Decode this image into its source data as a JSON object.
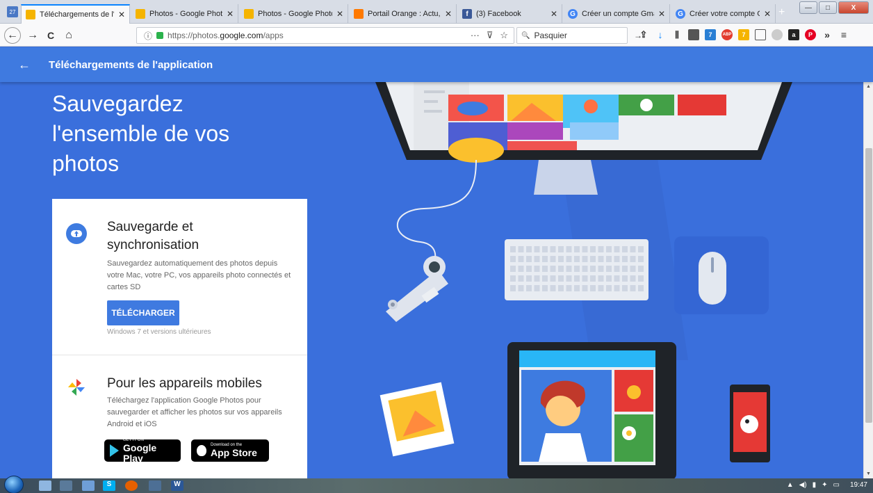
{
  "browser": {
    "tabs": [
      {
        "label": "Téléchargements de l'ap",
        "icon": "google-photos-icon",
        "active": true
      },
      {
        "label": "Photos - Google Photos",
        "icon": "google-photos-icon",
        "active": false
      },
      {
        "label": "Photos - Google Photos",
        "icon": "google-photos-icon",
        "active": false
      },
      {
        "label": "Portail Orange : Actu, Sp",
        "icon": "orange-icon",
        "active": false
      },
      {
        "label": "(3) Facebook",
        "icon": "facebook-icon",
        "active": false
      },
      {
        "label": "Créer un compte Gmail",
        "icon": "google-icon",
        "active": false
      },
      {
        "label": "Créer votre compte Goo",
        "icon": "google-icon",
        "active": false
      }
    ],
    "tab_close_glyph": "✕",
    "new_tab_glyph": "+",
    "calendar_badge": "27",
    "window": {
      "minimize": "—",
      "maximize": "□",
      "close": "X"
    },
    "url": {
      "scheme": "https://photos.",
      "host": "google.com",
      "path": "/apps"
    },
    "search_value": "Pasquier",
    "nav": {
      "back": "←",
      "forward": "→",
      "reload": "C",
      "home": "⌂"
    },
    "url_actions": {
      "more": "···",
      "pocket": "⊽",
      "bookmark": "☆"
    },
    "info_glyph": "ⓘ",
    "search_glyph": "🔍",
    "go_glyph": "→",
    "toolbar_badges": {
      "ext1": "7",
      "abp": "ABP",
      "ext2": "7",
      "amazon": "a",
      "pinterest": "P",
      "overflow": "»",
      "menu": "≡"
    }
  },
  "appbar": {
    "back": "←",
    "title": "Téléchargements de l'application"
  },
  "headline": "Sauvegardez l'ensemble de vos photos",
  "backup": {
    "title": "Sauvegarde et synchronisation",
    "description": "Sauvegardez automatiquement des photos depuis votre Mac, votre PC, vos appareils photo connectés et cartes SD",
    "button": "TÉLÉCHARGER",
    "note": "Windows 7 et versions ultérieures"
  },
  "mobile": {
    "title": "Pour les appareils mobiles",
    "description": "Téléchargez l'application Google Photos pour sauvegarder et afficher les photos sur vos appareils Android et iOS",
    "google_play": {
      "small": "GET IT ON",
      "big": "Google Play"
    },
    "app_store": {
      "small": "Download on the",
      "big": "App Store"
    }
  },
  "taskbar": {
    "time": "19:47"
  },
  "colors": {
    "page_blue": "#3a6fdc",
    "appbar_blue": "#3f7ae0",
    "button_blue": "#3f7ae0"
  }
}
